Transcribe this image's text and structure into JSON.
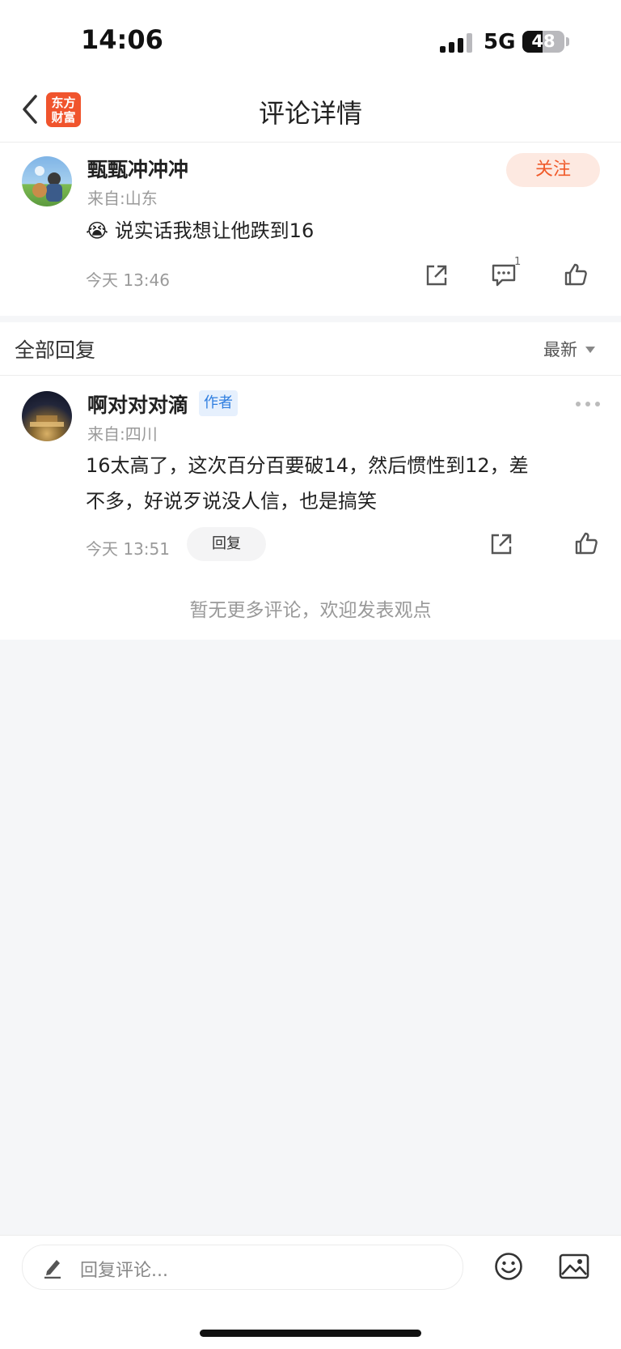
{
  "status_bar": {
    "time": "14:06",
    "network": "5G",
    "battery": "48",
    "battery_level": 0.48
  },
  "nav": {
    "title": "评论详情",
    "logo_line1": "东方",
    "logo_line2": "财富",
    "back_icon": "chevron-left-icon"
  },
  "main_comment": {
    "user": "甄甄冲冲冲",
    "from": "来自:山东",
    "emoji": "😭",
    "text": "说实话我想让他跌到16",
    "time": "今天 13:46",
    "follow_label": "关注",
    "reply_count": "1",
    "icons": [
      "share-icon",
      "comment-icon",
      "like-icon"
    ]
  },
  "replies": {
    "title": "全部回复",
    "sort_label": "最新",
    "items": [
      {
        "user": "啊对对对滴",
        "tag": "作者",
        "from": "来自:四川",
        "text_line1": "16太高了，这次百分百要破14，然后惯性到12，差",
        "text_line2": "不多，好说歹说没人信，也是搞笑",
        "time": "今天 13:51",
        "reply_label": "回复"
      }
    ],
    "empty_hint": "暂无更多评论，欢迎发表观点"
  },
  "bottom_bar": {
    "placeholder": "回复评论...",
    "icons": [
      "edit-icon",
      "emoji-icon",
      "image-icon"
    ]
  },
  "colors": {
    "accent": "#f05a2a",
    "author_tag": "#2f7ee0",
    "background": "#f5f6f8"
  }
}
